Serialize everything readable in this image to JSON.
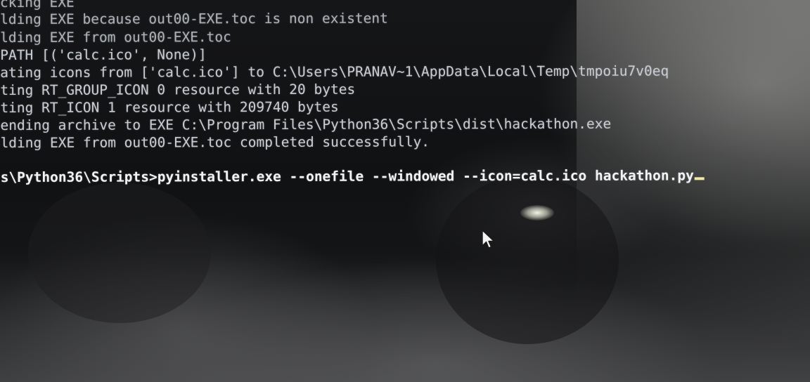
{
  "terminal": {
    "lines": [
      "cking EXE",
      "lding EXE because out00-EXE.toc is non existent",
      "lding EXE from out00-EXE.toc",
      "PATH [('calc.ico', None)]",
      "ating icons from ['calc.ico'] to C:\\Users\\PRANAV~1\\AppData\\Local\\Temp\\tmpoiu7v0eq",
      "ting RT_GROUP_ICON 0 resource with 20 bytes",
      "ting RT_ICON 1 resource with 209740 bytes",
      "ending archive to EXE C:\\Program Files\\Python36\\Scripts\\dist\\hackathon.exe",
      "lding EXE from out00-EXE.toc completed successfully."
    ],
    "prompt": "s\\Python36\\Scripts>",
    "command": "pyinstaller.exe --onefile --windowed --icon=calc.ico hackathon.py"
  },
  "icons": {
    "mouse_pointer": "arrow-pointer-icon",
    "text_cursor": "text-cursor-icon"
  },
  "colors": {
    "background": "#0d0d0e",
    "text": "#c9ccd2",
    "prompt_text": "#f2f3f5",
    "cursor": "#f1e9a8"
  }
}
